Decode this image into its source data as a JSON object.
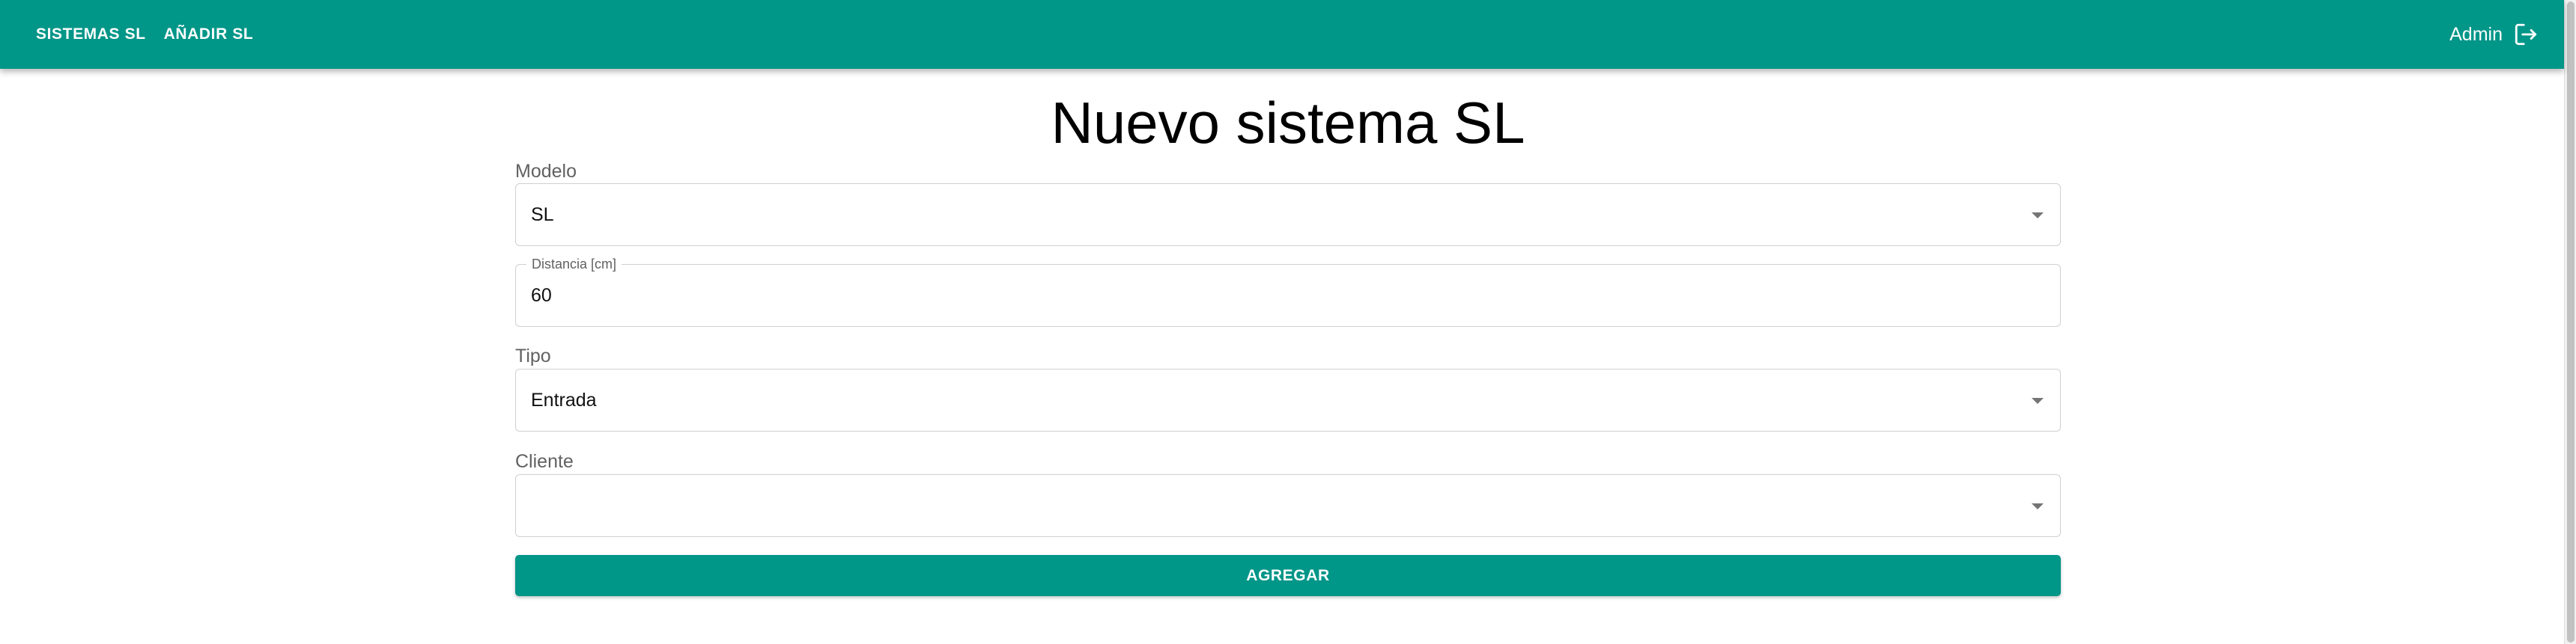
{
  "colors": {
    "primary": "#009688",
    "label": "#616161",
    "border": "#d0d0d0"
  },
  "header": {
    "nav": [
      {
        "label": "SISTEMAS SL"
      },
      {
        "label": "AÑADIR SL"
      }
    ],
    "user_name": "Admin",
    "logout_icon": "logout-icon"
  },
  "page": {
    "title": "Nuevo sistema SL"
  },
  "form": {
    "modelo": {
      "label": "Modelo",
      "value": "SL"
    },
    "distancia": {
      "label": "Distancia [cm]",
      "value": "60"
    },
    "tipo": {
      "label": "Tipo",
      "value": "Entrada"
    },
    "cliente": {
      "label": "Cliente",
      "value": ""
    },
    "submit_label": "AGREGAR"
  }
}
